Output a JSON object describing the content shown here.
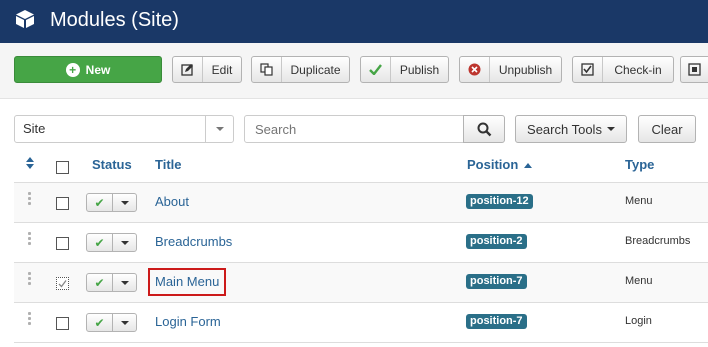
{
  "header": {
    "title": "Modules (Site)"
  },
  "toolbar": {
    "new_label": "New",
    "edit_label": "Edit",
    "duplicate_label": "Duplicate",
    "publish_label": "Publish",
    "unpublish_label": "Unpublish",
    "checkin_label": "Check-in"
  },
  "filters": {
    "client_value": "Site",
    "search_placeholder": "Search",
    "search_tools_label": "Search Tools",
    "clear_label": "Clear"
  },
  "table": {
    "columns": {
      "status": "Status",
      "title": "Title",
      "position": "Position",
      "type": "Type"
    },
    "rows": [
      {
        "title": "About",
        "position": "position-12",
        "type": "Menu"
      },
      {
        "title": "Breadcrumbs",
        "position": "position-2",
        "type": "Breadcrumbs"
      },
      {
        "title": "Main Menu",
        "position": "position-7",
        "type": "Menu"
      },
      {
        "title": "Login Form",
        "position": "position-7",
        "type": "Login"
      }
    ]
  }
}
